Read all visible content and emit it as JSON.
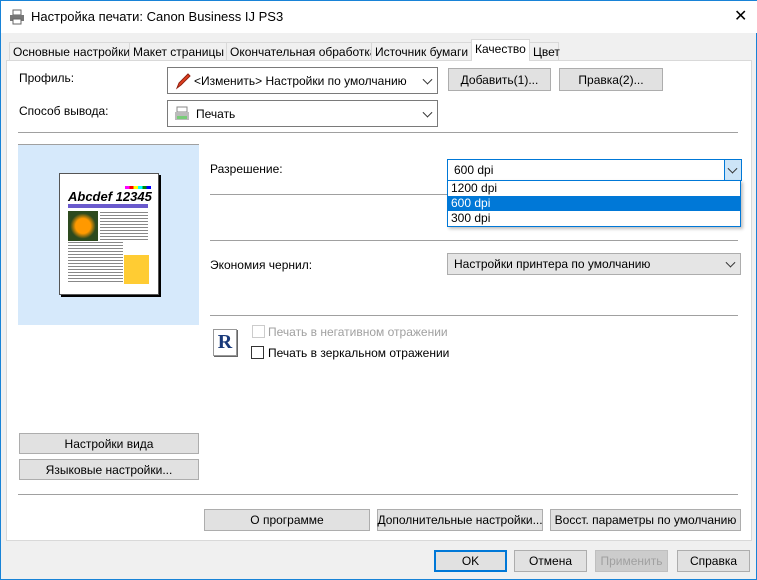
{
  "window": {
    "title": "Настройка печати: Canon Business IJ PS3",
    "close": "✕"
  },
  "tabs": [
    "Основные настройки",
    "Макет страницы",
    "Окончательная обработка",
    "Источник бумаги",
    "Качество",
    "Цвет"
  ],
  "profile": {
    "label": "Профиль:",
    "value": "<Изменить> Настройки по умолчанию",
    "add": "Добавить(1)...",
    "edit": "Правка(2)..."
  },
  "output": {
    "label": "Способ вывода:",
    "value": "Печать"
  },
  "preview": {
    "heading": "Abcdef 12345"
  },
  "resolution": {
    "label": "Разрешение:",
    "value": "600 dpi",
    "options": [
      "1200 dpi",
      "600 dpi",
      "300 dpi"
    ],
    "selected_index": 1
  },
  "ink": {
    "label": "Экономия чернил:",
    "value": "Настройки принтера по умолчанию"
  },
  "options": {
    "icon_letter": "R",
    "negative": "Печать в негативном отражении",
    "negative_checked": false,
    "negative_disabled": true,
    "mirror": "Печать в зеркальном отражении",
    "mirror_checked": false
  },
  "left_buttons": {
    "view": "Настройки вида",
    "lang": "Языковые настройки..."
  },
  "bottom_buttons": {
    "about": "О программе",
    "advanced": "Дополнительные настройки...",
    "restore": "Восст. параметры по умолчанию"
  },
  "footer": {
    "ok": "OK",
    "cancel": "Отмена",
    "apply": "Применить",
    "help": "Справка"
  },
  "colors": {
    "accent": "#0078d7",
    "preview_bg": "#d6e9fb"
  }
}
